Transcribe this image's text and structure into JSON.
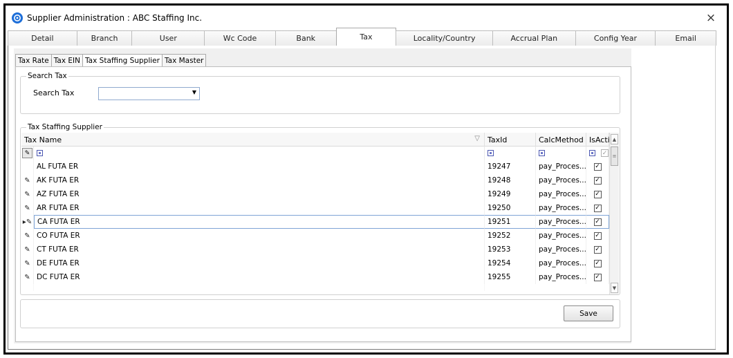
{
  "window": {
    "title": "Supplier Administration : ABC Staffing Inc.",
    "close_glyph": "×"
  },
  "main_tabs": [
    {
      "label": "Detail",
      "active": false
    },
    {
      "label": "Branch",
      "active": false
    },
    {
      "label": "User",
      "active": false
    },
    {
      "label": "Wc Code",
      "active": false
    },
    {
      "label": "Bank",
      "active": false
    },
    {
      "label": "Tax",
      "active": true
    },
    {
      "label": "Locality/Country",
      "active": false
    },
    {
      "label": "Accrual Plan",
      "active": false
    },
    {
      "label": "Config Year",
      "active": false
    },
    {
      "label": "Email",
      "active": false
    }
  ],
  "sub_tabs": [
    {
      "label": "Tax Rate",
      "active": false
    },
    {
      "label": "Tax EIN",
      "active": false
    },
    {
      "label": "Tax Staffing Supplier",
      "active": true
    },
    {
      "label": "Tax Master",
      "active": false
    }
  ],
  "search": {
    "group_title": "Search Tax",
    "label": "Search Tax",
    "value": ""
  },
  "grid": {
    "group_title": "Tax Staffing Supplier",
    "columns": {
      "name": "Tax Name",
      "id": "TaxId",
      "calc": "CalcMethod",
      "active": "IsActiv"
    },
    "rows": [
      {
        "name": "AL FUTA ER",
        "id": "19247",
        "calc": "pay_Proces...",
        "active": true,
        "indicator": ""
      },
      {
        "name": "AK FUTA ER",
        "id": "19248",
        "calc": "pay_Proces...",
        "active": true,
        "indicator": "pencil"
      },
      {
        "name": "AZ FUTA ER",
        "id": "19249",
        "calc": "pay_Proces...",
        "active": true,
        "indicator": "pencil"
      },
      {
        "name": "AR FUTA ER",
        "id": "19250",
        "calc": "pay_Proces...",
        "active": true,
        "indicator": "pencil"
      },
      {
        "name": "CA FUTA ER",
        "id": "19251",
        "calc": "pay_Proces...",
        "active": true,
        "indicator": "current",
        "selected": true
      },
      {
        "name": "CO FUTA ER",
        "id": "19252",
        "calc": "pay_Proces...",
        "active": true,
        "indicator": "pencil"
      },
      {
        "name": "CT FUTA ER",
        "id": "19253",
        "calc": "pay_Proces...",
        "active": true,
        "indicator": "pencil"
      },
      {
        "name": "DE FUTA ER",
        "id": "19254",
        "calc": "pay_Proces...",
        "active": true,
        "indicator": "pencil"
      },
      {
        "name": "DC FUTA ER",
        "id": "19255",
        "calc": "pay_Proces...",
        "active": true,
        "indicator": "pencil"
      }
    ]
  },
  "actions": {
    "save_label": "Save"
  },
  "colors": {
    "accent": "#7ea4d6",
    "app_icon": "#1e6fd9"
  },
  "icons": {
    "app": "gear-app-icon",
    "close": "close-icon",
    "pencil": "pencil-icon",
    "row_pointer": "row-pointer-icon"
  }
}
